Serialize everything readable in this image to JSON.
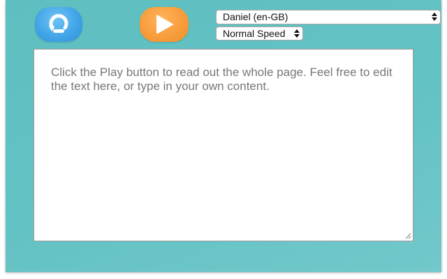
{
  "toolbar": {
    "replay_icon": "replay-icon",
    "play_icon": "play-icon",
    "replay_color": "#3fa3e6",
    "play_color": "#f79c3a"
  },
  "voice_select": {
    "selected": "Daniel (en-GB)"
  },
  "speed_select": {
    "selected": "Normal Speed"
  },
  "editor": {
    "placeholder": "Click the Play button to read out the whole page. Feel free to edit the text here, or type in your own content."
  },
  "theme": {
    "background": "#63c2c3"
  }
}
